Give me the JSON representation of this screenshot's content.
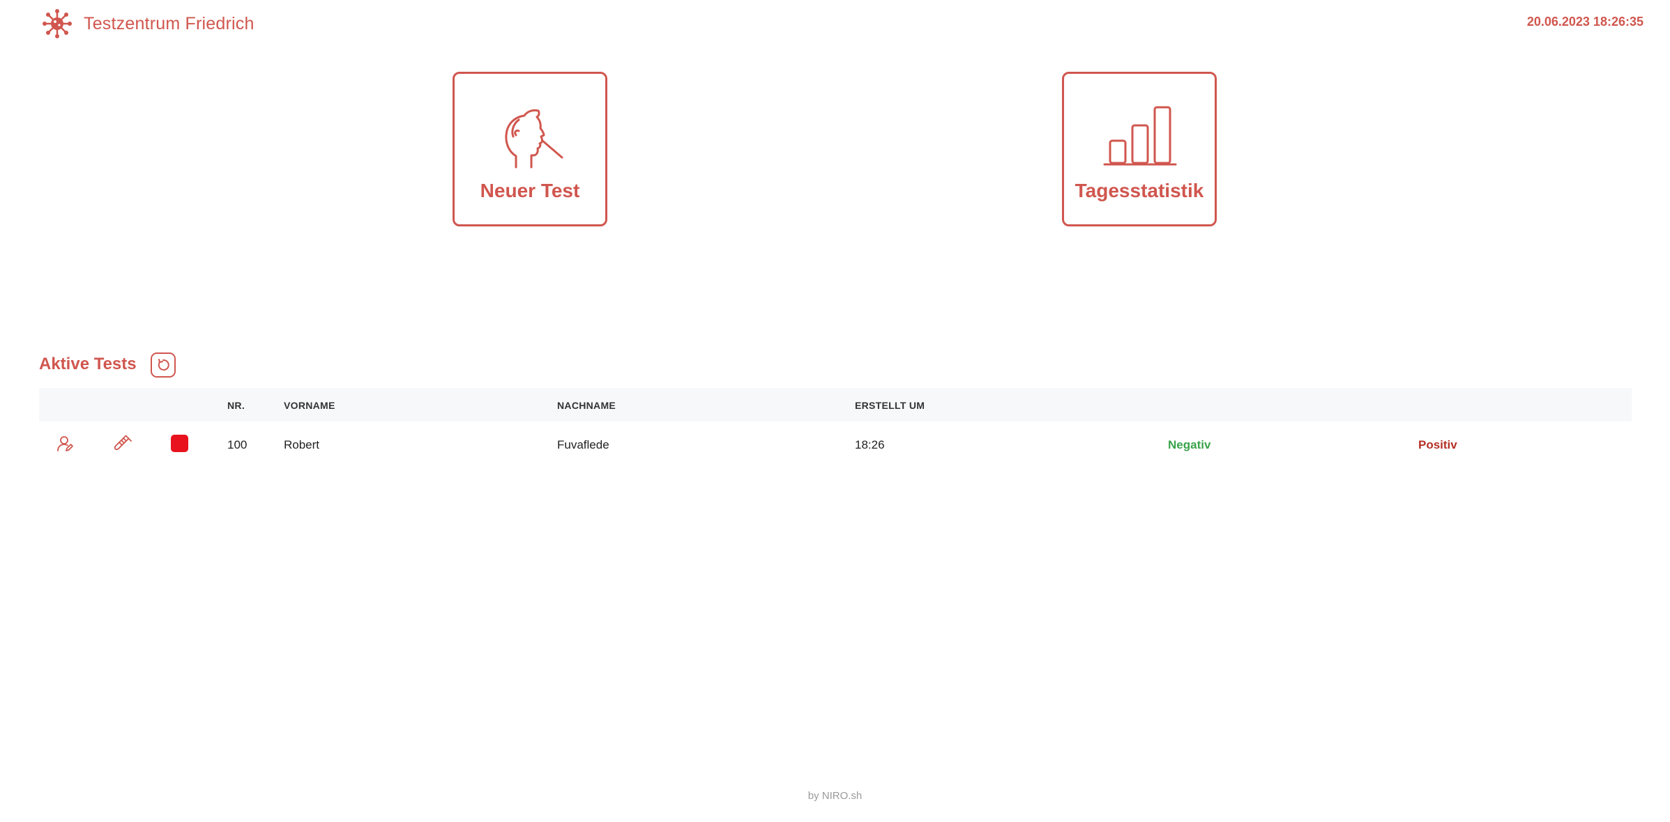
{
  "header": {
    "title": "Testzentrum Friedrich",
    "datetime": "20.06.2023 18:26:35",
    "logo_icon": "virus-icon"
  },
  "tiles": [
    {
      "label": "Neuer Test",
      "icon": "swab-test-icon"
    },
    {
      "label": "Tagesstatistik",
      "icon": "bar-chart-icon"
    }
  ],
  "active_tests": {
    "title": "Aktive Tests",
    "refresh_icon": "refresh-icon",
    "columns": [
      "NR.",
      "VORNAME",
      "NACHNAME",
      "ERSTELLT UM"
    ],
    "rows": [
      {
        "nr": "100",
        "vorname": "Robert",
        "nachname": "Fuvaflede",
        "erstellt_um": "18:26",
        "status_color": "#e8121e",
        "negative_label": "Negativ",
        "positive_label": "Positiv"
      }
    ]
  },
  "footer": {
    "text": "by NIRO.sh"
  },
  "colors": {
    "accent": "#d0564e",
    "negative": "#3aa34a",
    "positive": "#b53026"
  }
}
